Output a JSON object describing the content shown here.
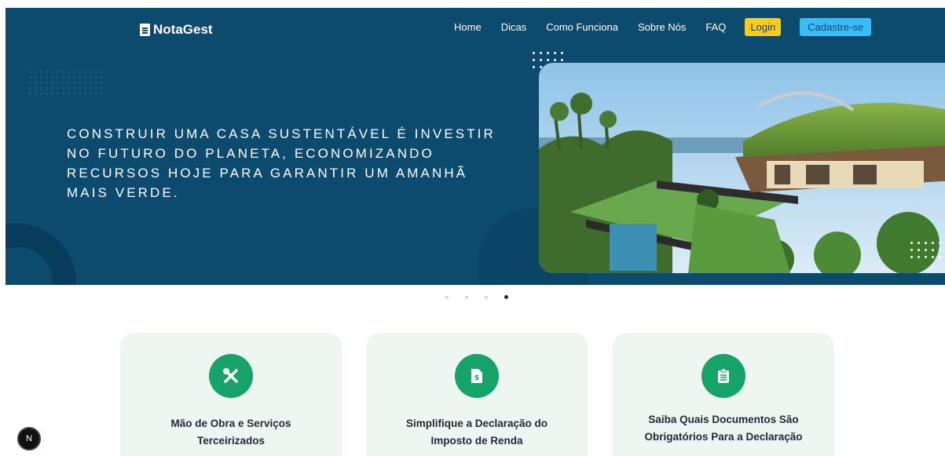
{
  "brand": {
    "name": "NotaGest",
    "icon": "document-icon"
  },
  "nav": {
    "links": [
      "Home",
      "Dicas",
      "Como Funciona",
      "Sobre Nós",
      "FAQ"
    ],
    "login_label": "Login",
    "signup_label": "Cadastre-se"
  },
  "hero": {
    "text": "Construir uma casa sustentável é investir no futuro do planeta, economizando recursos hoje para garantir um amanhã mais verde."
  },
  "carousel": {
    "slide_count": 4,
    "active_index": 3
  },
  "cards": [
    {
      "icon": "tools-icon",
      "title": "Mão de Obra e Serviços Terceirizados"
    },
    {
      "icon": "invoice-icon",
      "title": "Simplifique a Declaração do Imposto de Renda"
    },
    {
      "icon": "clipboard-icon",
      "title": "Saiba Quais Documentos São Obrigatórios Para a Declaração"
    }
  ],
  "dev_badge": {
    "label": "N"
  },
  "colors": {
    "hero_bg": "#0c4a6e",
    "login_bg": "#facc15",
    "signup_bg": "#38bdf8",
    "card_bg": "#eef6f2",
    "icon_bg": "#16a36a"
  }
}
